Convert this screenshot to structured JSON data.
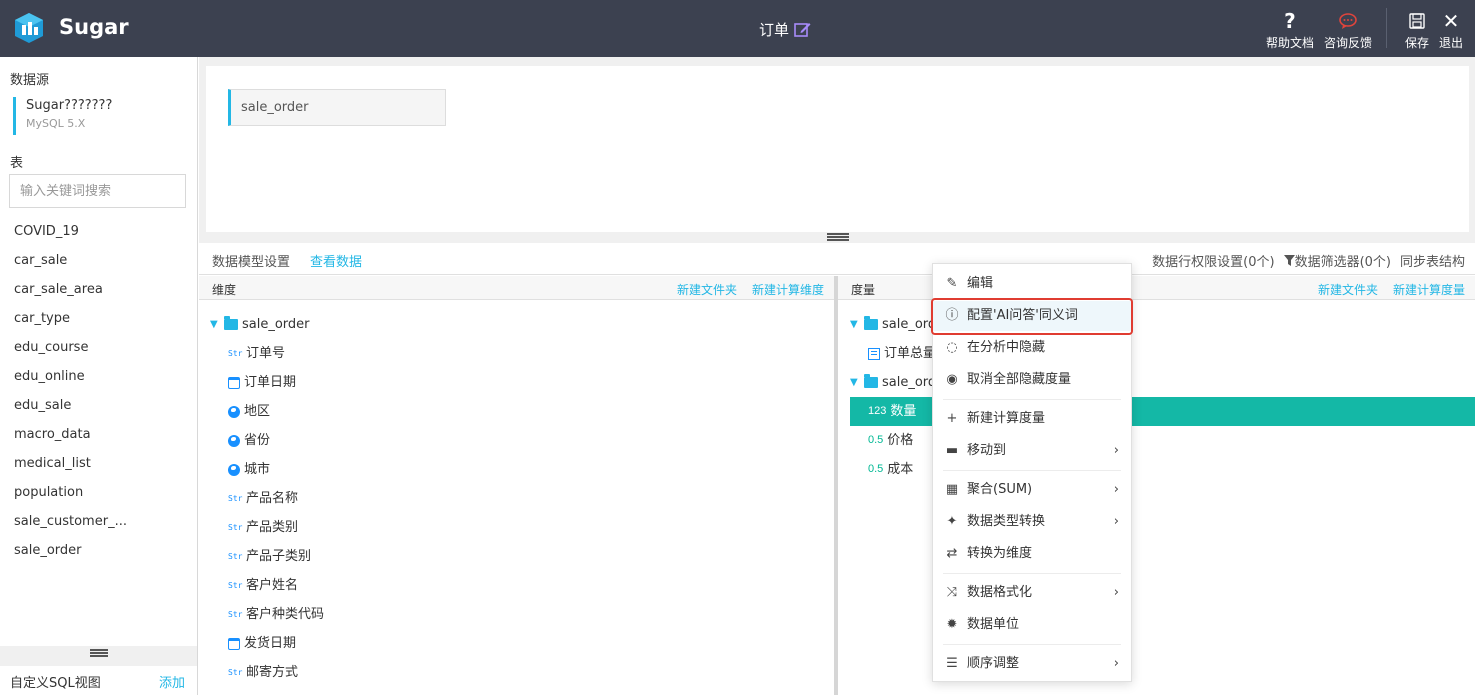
{
  "app": {
    "brand": "Sugar",
    "doc_title": "订单",
    "actions": [
      {
        "label": "帮助文档",
        "icon": "question-icon"
      },
      {
        "label": "咨询反馈",
        "icon": "chat-icon"
      },
      {
        "label": "保存",
        "icon": "save-icon"
      },
      {
        "label": "退出",
        "icon": "close-icon"
      }
    ]
  },
  "sidebar": {
    "datasource_label": "数据源",
    "datasource": {
      "name": "Sugar???????",
      "type": "MySQL 5.X"
    },
    "tables_label": "表",
    "search_placeholder": "输入关键词搜索",
    "tables": [
      "COVID_19",
      "car_sale",
      "car_sale_area",
      "car_type",
      "edu_course",
      "edu_online",
      "edu_sale",
      "macro_data",
      "medical_list",
      "population",
      "sale_customer_...",
      "sale_order"
    ],
    "custom_sql_label": "自定义SQL视图",
    "custom_sql_add": "添加"
  },
  "canvas": {
    "table": "sale_order"
  },
  "model_bar": {
    "left": "数据模型设置",
    "link": "查看数据",
    "right": [
      "数据行权限设置(0个)",
      "数据筛选器(0个)",
      "同步表结构"
    ]
  },
  "dimensions": {
    "title": "维度",
    "actions": [
      "新建文件夹",
      "新建计算维度"
    ],
    "folder": "sale_order",
    "fields": [
      {
        "type": "Str",
        "icon": "string-type-icon",
        "name": "订单号"
      },
      {
        "type": "date",
        "icon": "calendar-icon",
        "name": "订单日期"
      },
      {
        "type": "geo",
        "icon": "globe-icon",
        "name": "地区"
      },
      {
        "type": "geo",
        "icon": "globe-icon",
        "name": "省份"
      },
      {
        "type": "geo",
        "icon": "globe-icon",
        "name": "城市"
      },
      {
        "type": "Str",
        "icon": "string-type-icon",
        "name": "产品名称"
      },
      {
        "type": "Str",
        "icon": "string-type-icon",
        "name": "产品类别"
      },
      {
        "type": "Str",
        "icon": "string-type-icon",
        "name": "产品子类别"
      },
      {
        "type": "Str",
        "icon": "string-type-icon",
        "name": "客户姓名"
      },
      {
        "type": "Str",
        "icon": "string-type-icon",
        "name": "客户种类代码"
      },
      {
        "type": "date",
        "icon": "calendar-icon",
        "name": "发货日期"
      },
      {
        "type": "Str",
        "icon": "string-type-icon",
        "name": "邮寄方式"
      }
    ]
  },
  "measures": {
    "title": "度量",
    "actions": [
      "新建文件夹",
      "新建计算度量"
    ],
    "folder1": "sale_order",
    "folder1_field": "订单总量",
    "folder2": "sale_order",
    "fields": [
      {
        "type": "123",
        "name": "数量",
        "selected": true
      },
      {
        "type": "0.5",
        "name": "价格"
      },
      {
        "type": "0.5",
        "name": "成本"
      }
    ]
  },
  "context_menu": {
    "items": [
      {
        "label": "编辑",
        "icon": "edit-icon"
      },
      {
        "label": "配置'AI问答'同义词",
        "icon": "question-circle-icon",
        "highlighted": true
      },
      {
        "label": "在分析中隐藏",
        "icon": "eye-slash-icon"
      },
      {
        "label": "取消全部隐藏度量",
        "icon": "eye-icon"
      },
      {
        "label": "新建计算度量",
        "icon": "plus-icon"
      },
      {
        "label": "移动到",
        "icon": "folder-icon",
        "submenu": true
      },
      {
        "label": "聚合(SUM)",
        "icon": "calculator-icon",
        "submenu": true
      },
      {
        "label": "数据类型转换",
        "icon": "magic-icon",
        "submenu": true
      },
      {
        "label": "转换为维度",
        "icon": "swap-icon"
      },
      {
        "label": "数据格式化",
        "icon": "shuffle-icon",
        "submenu": true
      },
      {
        "label": "数据单位",
        "icon": "gear-icon"
      },
      {
        "label": "顺序调整",
        "icon": "list-icon",
        "submenu": true
      }
    ]
  },
  "colors": {
    "topbar": "#3c4150",
    "accent": "#23b7e5",
    "selected": "#14b8a6",
    "highlight_box": "#e03c31"
  }
}
